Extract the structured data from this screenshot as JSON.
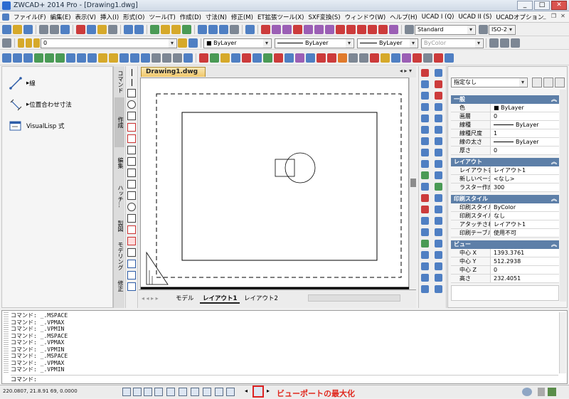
{
  "window": {
    "title": "ZWCAD+ 2014 Pro - [Drawing1.dwg]"
  },
  "menu": [
    "ファイル(F)",
    "編集(E)",
    "表示(V)",
    "挿入(I)",
    "形式(O)",
    "ツール(T)",
    "作成(D)",
    "寸法(N)",
    "修正(M)",
    "ET拡張ツール(X)",
    "SXF変換(S)",
    "ウィンドウ(W)",
    "ヘルプ(H)",
    "UCAD I (Q)",
    "UCAD II (S)",
    "UCADオプション"
  ],
  "toolbar": {
    "text_style": "Standard",
    "dim_style": "ISO-25",
    "layer": "0",
    "color": "ByLayer",
    "linetype": "ByLayer",
    "lineweight": "ByLayer",
    "plotstyle": "ByColor"
  },
  "tool_palette": {
    "items": [
      {
        "label": "線",
        "icon": "line-icon"
      },
      {
        "label": "位置合わせ寸法",
        "icon": "aligned-dimension-icon"
      },
      {
        "label": "VisualLisp 式",
        "icon": "visuallisp-icon"
      }
    ],
    "tabs": [
      "コマンド",
      "作成",
      "編集",
      "ハッチ…",
      "製図",
      "モデリング",
      "修正"
    ]
  },
  "document": {
    "tab": "Drawing1.dwg",
    "layout_tabs": [
      "モデル",
      "レイアウト1",
      "レイアウト2"
    ],
    "active_layout": "レイアウト1"
  },
  "properties": {
    "selection": "指定なし",
    "sections": [
      {
        "title": "一般",
        "rows": [
          {
            "k": "色",
            "v": "■ ByLayer"
          },
          {
            "k": "画層",
            "v": "0"
          },
          {
            "k": "線種",
            "v": "ByLayer"
          },
          {
            "k": "線種尺度",
            "v": "1"
          },
          {
            "k": "線の太さ",
            "v": "ByLayer"
          },
          {
            "k": "厚さ",
            "v": "0"
          }
        ]
      },
      {
        "title": "レイアウト",
        "rows": [
          {
            "k": "レイアウト名",
            "v": "レイアウト1"
          },
          {
            "k": "新しいページ...",
            "v": "<なし>"
          },
          {
            "k": "ラスター作成...",
            "v": "300"
          }
        ]
      },
      {
        "title": "印刷スタイル",
        "rows": [
          {
            "k": "印刷スタイル",
            "v": "ByColor"
          },
          {
            "k": "印刷スタイル...",
            "v": "なし"
          },
          {
            "k": "アタッチされた...",
            "v": "レイアウト1"
          },
          {
            "k": "印刷テーブル...",
            "v": "使用不可"
          }
        ]
      },
      {
        "title": "ビュー",
        "rows": [
          {
            "k": "中心 X",
            "v": "1393.3761"
          },
          {
            "k": "中心 Y",
            "v": "512.2938"
          },
          {
            "k": "中心 Z",
            "v": "0"
          },
          {
            "k": "高さ",
            "v": "232.4051"
          }
        ]
      }
    ]
  },
  "command": {
    "history": [
      "コマンド: _.MSPACE",
      "コマンド: _.VPMAX",
      "コマンド: _.VPMIN",
      "コマンド: _.MSPACE",
      "コマンド: _.VPMAX",
      "コマンド: _.VPMIN",
      "コマンド: _.MSPACE",
      "コマンド: _.VPMAX",
      "コマンド: _.VPMIN"
    ],
    "prompt": "コマンド:"
  },
  "status": {
    "coords": "220.0807, 21.8.91 69, 0.0000",
    "annotation": "ビューポートの最大化",
    "annotation_color": "#e0281e"
  }
}
